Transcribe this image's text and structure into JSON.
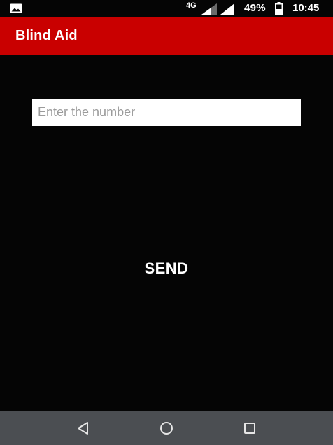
{
  "status_bar": {
    "network_type": "4G",
    "battery_percent": "49%",
    "time": "10:45",
    "left_icon": "image-icon",
    "icons": [
      "signal-icon",
      "signal-icon",
      "battery-icon"
    ]
  },
  "app_bar": {
    "title": "Blind Aid",
    "color": "#c90000"
  },
  "main": {
    "number_input": {
      "value": "",
      "placeholder": "Enter the number"
    },
    "send_label": "SEND"
  },
  "nav_bar": {
    "buttons": [
      "back-icon",
      "home-icon",
      "recents-icon"
    ]
  }
}
